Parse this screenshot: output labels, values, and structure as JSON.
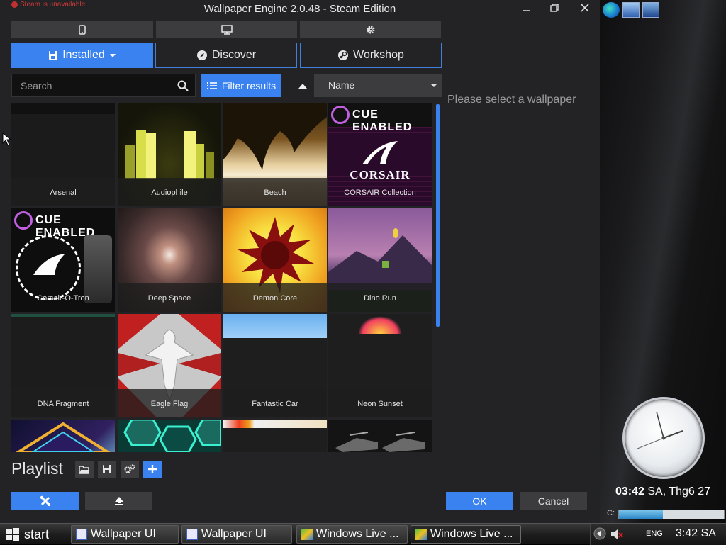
{
  "window": {
    "title": "Wallpaper Engine 2.0.48 - Steam Edition",
    "steam_warning": "Steam is unavailable."
  },
  "icon_tabs": [
    {
      "icon": "phone-icon"
    },
    {
      "icon": "monitor-icon"
    },
    {
      "icon": "gear-icon"
    }
  ],
  "nav_tabs": [
    {
      "label": "Installed",
      "icon": "save-icon",
      "active": true
    },
    {
      "label": "Discover",
      "icon": "compass-icon",
      "active": false
    },
    {
      "label": "Workshop",
      "icon": "steam-icon",
      "active": false
    }
  ],
  "search": {
    "placeholder": "Search",
    "value": ""
  },
  "filter": {
    "label": "Filter results"
  },
  "sort": {
    "selected": "Name"
  },
  "wallpapers": [
    {
      "label": "Arsenal"
    },
    {
      "label": "Audiophile"
    },
    {
      "label": "Beach"
    },
    {
      "label": "CORSAIR Collection",
      "badge": "CUE ENABLED",
      "brand": "CORSAIR"
    },
    {
      "label": "Corsair-O-Tron",
      "badge": "CUE ENABLED"
    },
    {
      "label": "Deep Space"
    },
    {
      "label": "Demon Core"
    },
    {
      "label": "Dino Run"
    },
    {
      "label": "DNA Fragment"
    },
    {
      "label": "Eagle Flag"
    },
    {
      "label": "Fantastic Car"
    },
    {
      "label": "Neon Sunset"
    },
    {
      "label": ""
    },
    {
      "label": ""
    },
    {
      "label": ""
    },
    {
      "label": ""
    }
  ],
  "preview": {
    "empty_message": "Please select a wallpaper"
  },
  "playlist": {
    "title": "Playlist"
  },
  "buttons": {
    "ok": "OK",
    "cancel": "Cancel"
  },
  "desktop": {
    "clock_time": "03:42",
    "clock_date": "SA, Thg6 27",
    "drive_label": "C:",
    "drive_usage": 0.42
  },
  "taskbar": {
    "start": "start",
    "tasks": [
      {
        "label": "Wallpaper UI",
        "active": false
      },
      {
        "label": "Wallpaper UI",
        "active": false
      },
      {
        "label": "Windows Live ...",
        "active": false
      },
      {
        "label": "Windows Live ...",
        "active": true
      }
    ],
    "lang": "ENG",
    "time": "3:42 SA"
  },
  "colors": {
    "accent": "#3a82f0",
    "panel": "#232325",
    "tab": "#3c3c3e"
  }
}
